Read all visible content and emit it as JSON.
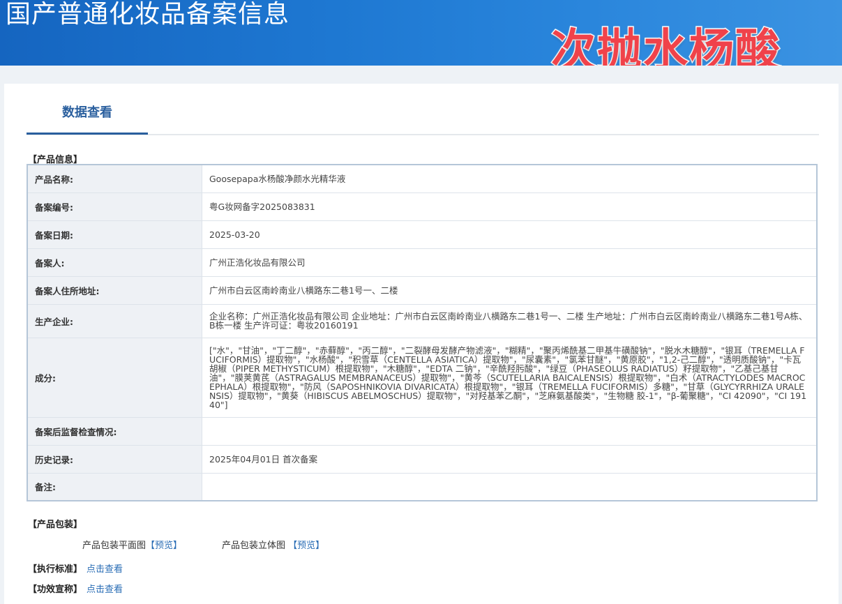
{
  "banner": {
    "title": "国产普通化妆品备案信息",
    "overlay_text": "次抛水杨酸"
  },
  "tab": {
    "active_label": "数据查看"
  },
  "product_info": {
    "section_label": "【产品信息】",
    "rows": [
      {
        "label": "产品名称:",
        "value": "Goosepapa水杨酸净颜水光精华液"
      },
      {
        "label": "备案编号:",
        "value": "粤G妆网备字2025083831"
      },
      {
        "label": "备案日期:",
        "value": "2025-03-20"
      },
      {
        "label": "备案人:",
        "value": "广州正浩化妆品有限公司"
      },
      {
        "label": "备案人住所地址:",
        "value": "广州市白云区南岭南业八横路东二巷1号一、二楼"
      },
      {
        "label": "生产企业:",
        "value": "企业名称：广州正浩化妆品有限公司 企业地址：广州市白云区南岭南业八横路东二巷1号一、二楼 生产地址：广州市白云区南岭南业八横路东二巷1号A栋、B栋一楼 生产许可证：粤妆20160191"
      },
      {
        "label": "成分:",
        "value": "[\"水\"，\"甘油\"，\"丁二醇\"，\"赤藓醇\"，\"丙二醇\"，\"二裂酵母发酵产物滤液\"，\"糊精\"，\"聚丙烯酰基二甲基牛磺酸钠\"，\"脱水木糖醇\"，\"银耳（TREMELLA FUCIFORMIS）提取物\"，\"水杨酸\"，\"积雪草（CENTELLA ASIATICA）提取物\"，\"尿囊素\"，\"氯苯甘醚\"，\"黄原胶\"，\"1,2-己二醇\"，\"透明质酸钠\"，\"卡瓦胡椒（PIPER METHYSTICUM）根提取物\"，\"木糖醇\"，\"EDTA 二钠\"，\"辛酰羟肟酸\"，\"绿豆（PHASEOLUS RADIATUS）籽提取物\"，\"乙基己基甘油\"，\"膜荚黄芪（ASTRAGALUS MEMBRANACEUS）提取物\"，\"黄芩（SCUTELLARIA BAICALENSIS）根提取物\"，\"白术（ATRACTYLODES MACROCEPHALA）根提取物\"，\"防风（SAPOSHNIKOVIA DIVARICATA）根提取物\"，\"银耳（TREMELLA FUCIFORMIS）多糖\"，\"甘草（GLYCYRRHIZA URALENSIS）提取物\"，\"黄葵（HIBISCUS ABELMOSCHUS）提取物\"，\"对羟基苯乙酮\"，\"芝麻氨基酸类\"，\"生物糖 胶-1\"，\"β-葡聚糖\"，\"CI 42090\"，\"CI 19140\"]"
      },
      {
        "label": "备案后监督检查情况:",
        "value": ""
      },
      {
        "label": "历史记录:",
        "value": "2025年04月01日 首次备案"
      },
      {
        "label": "备注:",
        "value": ""
      }
    ]
  },
  "packaging": {
    "section_label": "【产品包装】",
    "flat_label": "产品包装平面图",
    "flat_link": "【预览】",
    "solid_label": "产品包装立体图",
    "solid_link": "【预览】"
  },
  "standard": {
    "label": "【执行标准】",
    "link": "点击查看"
  },
  "claims": {
    "label": "【功效宣称】",
    "link": "点击查看"
  }
}
